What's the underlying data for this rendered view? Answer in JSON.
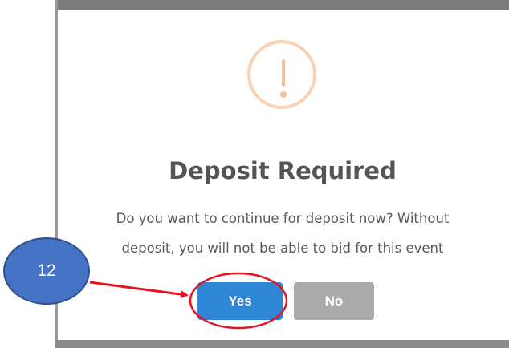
{
  "dialog": {
    "title": "Deposit Required",
    "message_line1": "Do you want to continue for deposit now? Without",
    "message_line2": "deposit, you will not be able to bid for this event",
    "yes_label": "Yes",
    "no_label": "No",
    "icon": "exclamation-circle-icon"
  },
  "annotation": {
    "step_number": "12",
    "highlight_target": "Yes",
    "badge_color": "#4472c4",
    "arrow_color": "#e8131f",
    "highlight_color": "#e8131f"
  },
  "colors": {
    "yes_button": "#2f86d7",
    "no_button": "#aaaaaa",
    "warning_icon": "#f3c095",
    "title_text": "#545454"
  }
}
